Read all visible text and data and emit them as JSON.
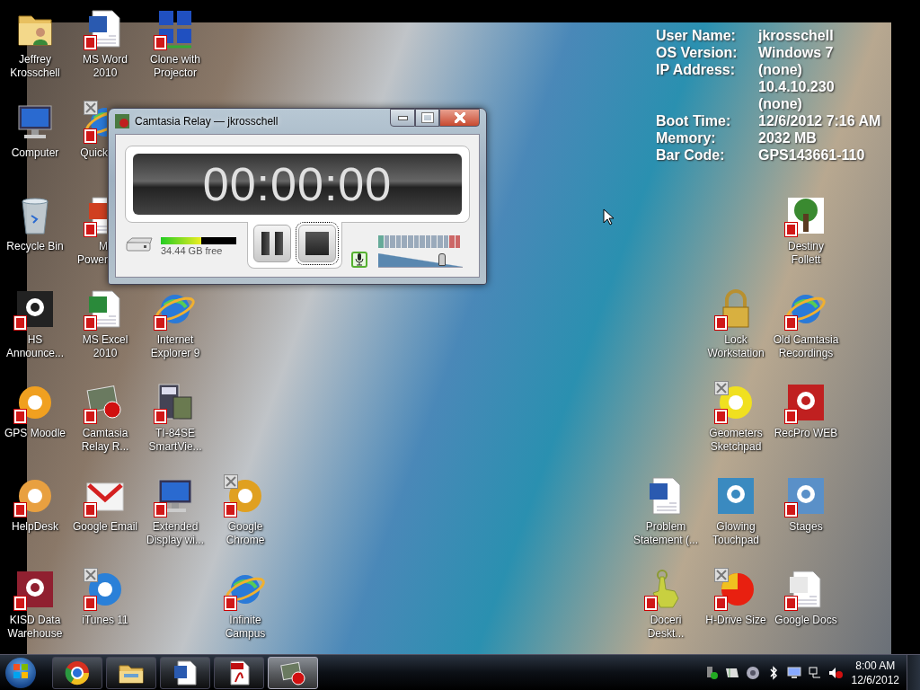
{
  "desktop_icons": [
    {
      "label": "Jeffrey\nKrosschell"
    },
    {
      "label": "Computer"
    },
    {
      "label": "Recycle Bin"
    },
    {
      "label": "HS\nAnnounce..."
    },
    {
      "label": "GPS Moodle"
    },
    {
      "label": "HelpDesk"
    },
    {
      "label": "KISD Data\nWarehouse"
    },
    {
      "label": "MS Word\n2010"
    },
    {
      "label": "Quick"
    },
    {
      "label": "M\nPower"
    },
    {
      "label": "MS Excel 2010"
    },
    {
      "label": "Camtasia\nRelay R..."
    },
    {
      "label": "Google Email"
    },
    {
      "label": "iTunes 11"
    },
    {
      "label": "Clone with\nProjector"
    },
    {
      "label": "Internet\nExplorer 9"
    },
    {
      "label": "TI-84SE\nSmartVie..."
    },
    {
      "label": "Extended\nDisplay wi..."
    },
    {
      "label": "Google\nChrome"
    },
    {
      "label": "Infinite\nCampus"
    },
    {
      "label": "Destiny\nFollett"
    },
    {
      "label": "Lock\nWorkstation"
    },
    {
      "label": "Old Camtasia\nRecordings"
    },
    {
      "label": "Geometers\nSketchpad"
    },
    {
      "label": "RecPro WEB"
    },
    {
      "label": "Problem\nStatement (..."
    },
    {
      "label": "Glowing\nTouchpad"
    },
    {
      "label": "Stages"
    },
    {
      "label": "Doceri\nDeskt..."
    },
    {
      "label": "H-Drive Size"
    },
    {
      "label": "Google Docs"
    }
  ],
  "system_info": [
    {
      "label": "User Name:",
      "value": "jkrosschell"
    },
    {
      "label": "OS Version:",
      "value": "Windows 7"
    },
    {
      "label": "IP Address:",
      "value": "(none)"
    },
    {
      "value": "10.4.10.230"
    },
    {
      "value": "(none)"
    },
    {
      "label": "Boot Time:",
      "value": "12/6/2012 7:16 AM"
    },
    {
      "label": "Memory:",
      "value": "2032 MB"
    },
    {
      "label": "Bar Code:",
      "value": "GPS143661-110"
    }
  ],
  "relay_window": {
    "title": "Camtasia Relay — jkrosschell",
    "timer": "00:00:00",
    "disk": {
      "level": 0.54,
      "free": "34.44 GB free"
    },
    "buttons": [
      {
        "kind": "pause",
        "focused": false
      },
      {
        "kind": "stop",
        "focused": true
      }
    ],
    "microphone": {
      "on": true
    },
    "volume": {
      "level": 0.75
    }
  },
  "taskbar": {
    "tasks": [
      {
        "selected": false
      },
      {
        "selected": false
      },
      {
        "selected": false
      },
      {
        "selected": false
      },
      {
        "selected": true
      }
    ],
    "clock": {
      "time": "8:00 AM",
      "date": "12/6/2012"
    }
  }
}
